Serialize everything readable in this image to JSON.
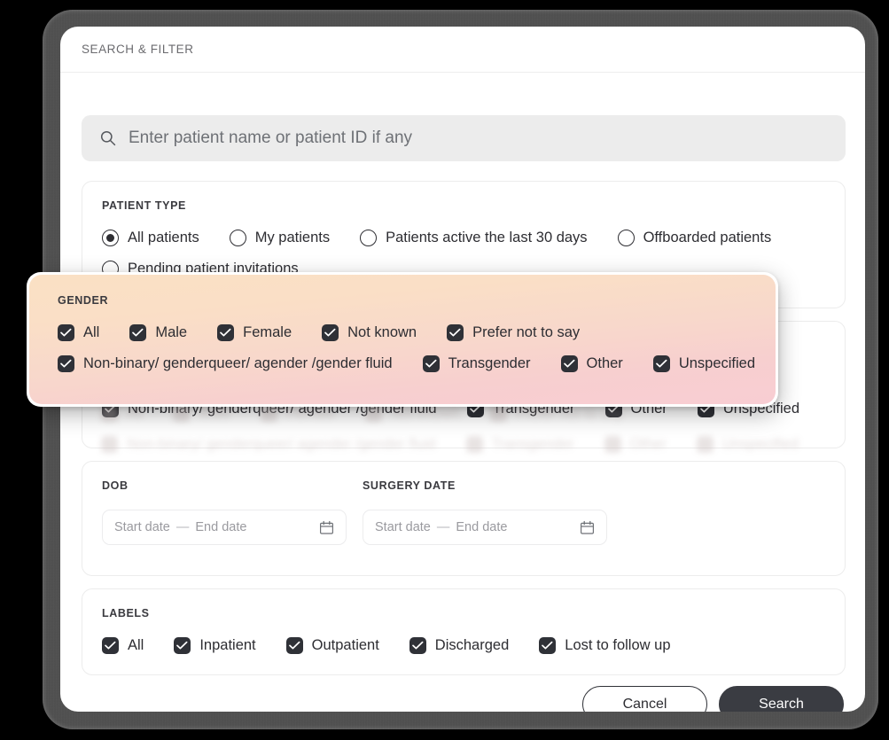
{
  "header": {
    "title": "SEARCH & FILTER"
  },
  "search": {
    "placeholder": "Enter patient name or patient ID if any",
    "value": "",
    "icon": "search-icon"
  },
  "patient_type": {
    "label": "PATIENT TYPE",
    "options": [
      {
        "label": "All patients",
        "selected": true
      },
      {
        "label": "My patients",
        "selected": false
      },
      {
        "label": "Patients active the last 30 days",
        "selected": false
      },
      {
        "label": "Offboarded patients",
        "selected": false
      },
      {
        "label": "Pending patient invitations",
        "selected": false
      }
    ]
  },
  "gender": {
    "label": "GENDER",
    "options": [
      {
        "label": "All",
        "checked": true
      },
      {
        "label": "Male",
        "checked": true
      },
      {
        "label": "Female",
        "checked": true
      },
      {
        "label": "Not known",
        "checked": true
      },
      {
        "label": "Prefer not to say",
        "checked": true
      },
      {
        "label": "Non-binary/ genderqueer/ agender /gender fluid",
        "checked": true
      },
      {
        "label": "Transgender",
        "checked": true
      },
      {
        "label": "Other",
        "checked": true
      },
      {
        "label": "Unspecified",
        "checked": true
      }
    ]
  },
  "dates": {
    "dob_label": "DOB",
    "surgery_label": "SURGERY DATE",
    "start_placeholder": "Start date",
    "separator": "—",
    "end_placeholder": "End date",
    "dob_start_value": "",
    "dob_end_value": "",
    "surgery_start_value": "",
    "surgery_end_value": "",
    "icon": "calendar-icon"
  },
  "labels": {
    "label": "LABELS",
    "options": [
      {
        "label": "All",
        "checked": true
      },
      {
        "label": "Inpatient",
        "checked": true
      },
      {
        "label": "Outpatient",
        "checked": true
      },
      {
        "label": "Discharged",
        "checked": true
      },
      {
        "label": "Lost to follow up",
        "checked": true
      }
    ]
  },
  "footer": {
    "cancel_label": "Cancel",
    "search_label": "Search"
  },
  "colors": {
    "accent_dark": "#3a3c42",
    "checkbox_dark": "#2f3137",
    "overlay_gradient_start": "#fae0c4",
    "overlay_gradient_end": "#f8cdd3",
    "search_bg": "#ececec",
    "frame": "#4f4f4f"
  }
}
